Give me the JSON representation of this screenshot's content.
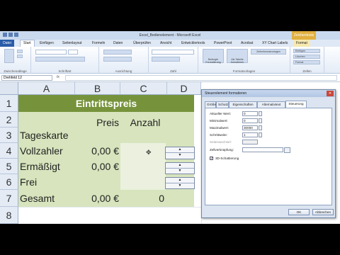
{
  "window": {
    "title": "Excel_Bedienelement - Microsoft Excel",
    "context_tab": "Zeichentools"
  },
  "ribbon": {
    "tabs": [
      "Datei",
      "Start",
      "Einfügen",
      "Seitenlayout",
      "Formeln",
      "Daten",
      "Überprüfen",
      "Ansicht",
      "Entwicklertools",
      "PowerPivot",
      "Acrobat",
      "XY Chart Labels",
      "Format"
    ],
    "active_tab": "Start",
    "groups": [
      "Zwischenablage",
      "Schriftart",
      "Ausrichtung",
      "Zahl",
      "Formatvorlagen",
      "Zellen"
    ],
    "buttons": {
      "conditional": "Bedingte Formatierung",
      "as_table": "Als Tabelle formatieren",
      "cell_styles": "Zellenformatvorlagen",
      "insert": "Einfügen",
      "delete": "Löschen",
      "format": "Format",
      "standard": "Standard"
    }
  },
  "formula_bar": {
    "name_box": "Drehfeld 12",
    "fx": "fx",
    "value": ""
  },
  "sheet": {
    "columns": [
      "A",
      "B",
      "C",
      "D"
    ],
    "rows": [
      "1",
      "2",
      "3",
      "4",
      "5",
      "6",
      "7",
      "8"
    ],
    "title": "Eintrittspreis",
    "header_preis": "Preis",
    "header_anzahl": "Anzahl",
    "labels": [
      "Tageskarte",
      "Vollzahler",
      "Ermäßigt",
      "Frei",
      "Gesamt"
    ],
    "prices": {
      "vollzahler": "0,00 €",
      "ermaessigt": "0,00 €",
      "gesamt": "0,00 €"
    },
    "count_gesamt": "0",
    "colors": {
      "title_bg": "#76933c",
      "body_bg": "#d7e4bd",
      "title_text": "#ffffff"
    }
  },
  "dialog": {
    "title": "Steuerelement formatieren",
    "tabs": [
      "Größe",
      "Schutz",
      "Eigenschaften",
      "Alternativtext",
      "Steuerung"
    ],
    "active_tab": "Steuerung",
    "fields": {
      "current_label": "Aktueller Wert:",
      "current_value": "0",
      "min_label": "Minimalwert:",
      "min_value": "0",
      "max_label": "Maximalwert:",
      "max_value": "30000",
      "step_label": "Schrittweite:",
      "step_value": "1",
      "page_label": "Seitenwechsel:",
      "page_value": "",
      "link_label": "Zellverknüpfung:",
      "link_value": ""
    },
    "checkbox_3d_label": "3D-Schattierung",
    "checkbox_3d_checked": true,
    "ok_label": "OK",
    "cancel_label": "Abbrechen"
  }
}
